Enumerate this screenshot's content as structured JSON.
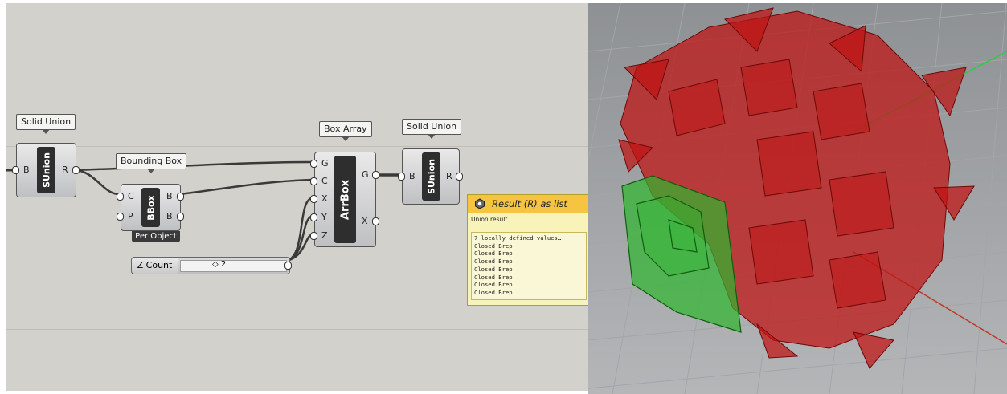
{
  "canvas": {
    "solid_union_1": {
      "tag": "Solid Union",
      "nickname": "SUnion",
      "inputs": [
        "B"
      ],
      "outputs": [
        "R"
      ]
    },
    "bounding_box": {
      "tag": "Bounding Box",
      "nickname": "BBox",
      "inputs": [
        "C",
        "P"
      ],
      "outputs": [
        "B",
        "B"
      ],
      "option": "Per Object"
    },
    "box_array": {
      "tag": "Box Array",
      "nickname": "ArrBox",
      "inputs": [
        "G",
        "C",
        "X",
        "Y",
        "Z"
      ],
      "outputs": [
        "G",
        "X"
      ]
    },
    "solid_union_2": {
      "tag": "Solid Union",
      "nickname": "SUnion",
      "inputs": [
        "B"
      ],
      "outputs": [
        "R"
      ]
    },
    "slider": {
      "label": "Z Count",
      "value": "◇ 2"
    },
    "tooltip": {
      "title": "Result (R) as list",
      "subtitle": "Union result",
      "lines": [
        "7 locally defined values…",
        "Closed Brep",
        "Closed Brep",
        "Closed Brep",
        "Closed Brep",
        "Closed Brep",
        "Closed Brep",
        "Closed Brep"
      ]
    }
  },
  "colors": {
    "canvas": "#d3d1cb",
    "tooltip_header": "#f5c542",
    "red_geometry": "#c01212",
    "green_geometry": "#2db62d"
  }
}
